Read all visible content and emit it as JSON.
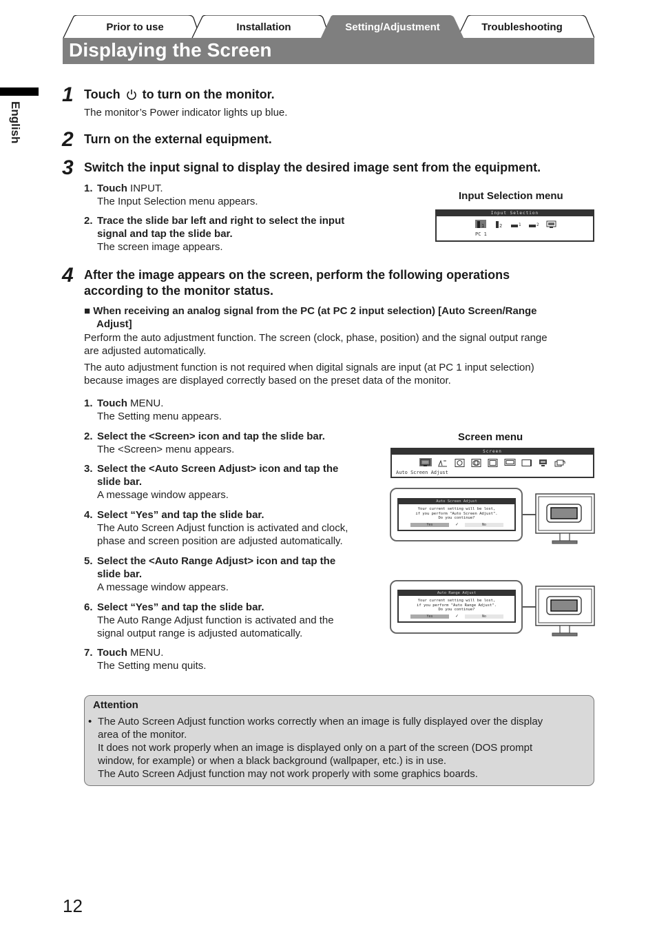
{
  "tabs": [
    {
      "label": "Prior to use",
      "active": false
    },
    {
      "label": "Installation",
      "active": false
    },
    {
      "label": "Setting/Adjustment",
      "active": true
    },
    {
      "label": "Troubleshooting",
      "active": false
    }
  ],
  "page_title": "Displaying the Screen",
  "language_marker": "English",
  "colors": {
    "title_bar": "#7f7f7f",
    "attention_bg": "#d9d9d9"
  },
  "steps": [
    {
      "number": "1",
      "title_before_icon": "Touch",
      "icon": "power-icon",
      "title_after_icon": "to turn on the monitor.",
      "body": "The monitor’s Power indicator lights up blue."
    },
    {
      "number": "2",
      "title": "Turn on the external equipment."
    },
    {
      "number": "3",
      "title": "Switch the input signal to display the desired image sent from the equipment.",
      "substeps": [
        {
          "n": "1.",
          "bold": "Touch",
          "plain": " INPUT.",
          "body": "The Input Selection menu appears."
        },
        {
          "n": "2.",
          "bold_lines": [
            "Trace the slide bar left and right to select the input",
            "signal and tap the slide bar."
          ],
          "body": "The screen image appears."
        }
      ]
    },
    {
      "number": "4",
      "title_lines": [
        "After the image appears on the screen, perform the following operations",
        "according to the monitor status."
      ],
      "section_heading_lines": [
        "When receiving an analog signal from the PC (at PC 2 input selection) [Auto Screen/Range",
        "Adjust]"
      ],
      "para1_lines": [
        "Perform the auto adjustment function. The screen (clock, phase, position) and the signal output range",
        "are adjusted automatically."
      ],
      "para2_lines": [
        "The auto adjustment function is not required when digital signals are input (at PC 1 input selection)",
        "because images are displayed correctly based on the preset data of the monitor."
      ],
      "substeps": [
        {
          "n": "1.",
          "bold": "Touch",
          "plain": " MENU.",
          "body_lines": [
            "The Setting menu appears."
          ]
        },
        {
          "n": "2.",
          "bold_lines": [
            "Select the <Screen> icon and tap the slide bar."
          ],
          "body_lines": [
            "The <Screen> menu appears."
          ]
        },
        {
          "n": "3.",
          "bold_lines": [
            "Select the <Auto Screen Adjust> icon and tap the",
            "slide bar."
          ],
          "body_lines": [
            "A message window appears."
          ]
        },
        {
          "n": "4.",
          "bold_lines": [
            "Select “Yes” and tap the slide bar."
          ],
          "body_lines": [
            "The Auto Screen Adjust function is activated and clock,",
            "phase and screen position are adjusted automatically."
          ]
        },
        {
          "n": "5.",
          "bold_lines": [
            "Select the <Auto Range Adjust> icon and tap the",
            "slide bar."
          ],
          "body_lines": [
            "A message window appears."
          ]
        },
        {
          "n": "6.",
          "bold_lines": [
            "Select “Yes” and tap the slide bar."
          ],
          "body_lines": [
            "The Auto Range Adjust function is activated and the",
            "signal output range is adjusted automatically."
          ]
        },
        {
          "n": "7.",
          "bold": "Touch",
          "plain": " MENU.",
          "body_lines": [
            "The Setting menu quits."
          ]
        }
      ]
    }
  ],
  "figures": {
    "input_selection": {
      "caption": "Input Selection menu",
      "osd_title": "Input Selection",
      "selected_label": "PC 1",
      "icons": [
        "pc1-dvi-icon",
        "pc2-dsub-icon",
        "video1-icon",
        "video2-icon",
        "pip-icon"
      ]
    },
    "screen_menu": {
      "caption": "Screen menu",
      "osd_title": "Screen",
      "selected_label": "Auto Screen Adjust",
      "icons": [
        "auto-screen-adjust-icon",
        "auto-range-adjust-icon",
        "clock-icon",
        "phase-icon",
        "hor-position-icon",
        "ver-position-icon",
        "resolution-icon",
        "signal-filter-icon",
        "return-icon"
      ]
    },
    "auto_screen_dialog": {
      "title": "Auto Screen Adjust",
      "lines": [
        "Your current setting will be lost,",
        "if you perform \"Auto Screen Adjust\".",
        "Do you continue?"
      ],
      "yes": "Yes",
      "check": "✓",
      "no": "No"
    },
    "auto_range_dialog": {
      "title": "Auto Range Adjust",
      "lines": [
        "Your current setting will be lost,",
        "if you perform \"Auto Range Adjust\".",
        "Do you continue?"
      ],
      "yes": "Yes",
      "check": "✓",
      "no": "No"
    }
  },
  "attention": {
    "title": "Attention",
    "bullet": "•",
    "lines": [
      "The Auto Screen Adjust function works correctly when an image is fully displayed over the display",
      "area of the monitor.",
      "It does not work properly when an image is displayed only on a part of the screen (DOS prompt",
      "window, for example) or when a black background (wallpaper, etc.) is in use.",
      "The Auto Screen Adjust function may not work properly with some graphics boards."
    ]
  },
  "page_number": "12"
}
